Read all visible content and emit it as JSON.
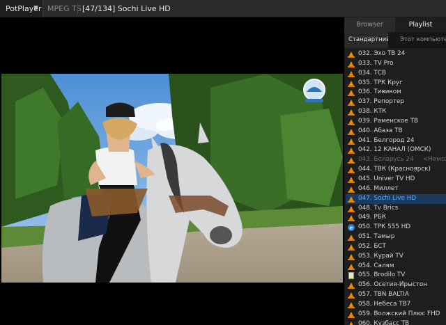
{
  "titlebar": {
    "app_menu": "PotPlayer",
    "format": "MPEG TS",
    "title": "[47/134] Sochi Live HD"
  },
  "panel": {
    "tabs": [
      {
        "label": "Browser",
        "active": false
      },
      {
        "label": "Playlist",
        "active": true
      }
    ],
    "subtabs": [
      {
        "label": "Стандартний",
        "active": true
      },
      {
        "label": "Этот компьютер",
        "active": false
      }
    ],
    "playlist": [
      {
        "label": "032. Эхо ТВ 24",
        "icon": "vlc-cone-icon"
      },
      {
        "label": "033. TV Pro",
        "icon": "vlc-cone-icon"
      },
      {
        "label": "034. ТСВ",
        "icon": "vlc-cone-icon"
      },
      {
        "label": "035. ТРК Круг",
        "icon": "vlc-cone-icon"
      },
      {
        "label": "036. Тивиком",
        "icon": "vlc-cone-icon"
      },
      {
        "label": "037. Репортер",
        "icon": "vlc-cone-icon"
      },
      {
        "label": "038. КТК",
        "icon": "vlc-cone-icon"
      },
      {
        "label": "039. Раменское ТВ",
        "icon": "vlc-cone-icon"
      },
      {
        "label": "040. Абаза ТВ",
        "icon": "vlc-cone-icon"
      },
      {
        "label": "041. Белгород 24",
        "icon": "vlc-cone-icon"
      },
      {
        "label": "042. 12 КАНАЛ (ОМСК)",
        "icon": "vlc-cone-icon"
      },
      {
        "label": "043. Беларусь 24",
        "suffix": "<Неможл",
        "icon": "vlc-cone-icon",
        "state": "dim"
      },
      {
        "label": "044. ТВК (Красноярск)",
        "icon": "vlc-cone-icon"
      },
      {
        "label": "045. Univer TV HD",
        "icon": "vlc-cone-icon"
      },
      {
        "label": "046. Миллет",
        "icon": "vlc-cone-icon"
      },
      {
        "label": "047. Sochi Live HD",
        "icon": "vlc-cone-icon",
        "state": "active"
      },
      {
        "label": "048. Tv Brics",
        "icon": "vlc-cone-icon"
      },
      {
        "label": "049. РБК",
        "icon": "vlc-cone-icon"
      },
      {
        "label": "050. ТРК 555 HD",
        "icon": "ie-icon"
      },
      {
        "label": "051. Тамыр",
        "icon": "vlc-cone-icon"
      },
      {
        "label": "052. БСТ",
        "icon": "vlc-cone-icon"
      },
      {
        "label": "053. Курай TV",
        "icon": "vlc-cone-icon"
      },
      {
        "label": "054. Салям",
        "icon": "vlc-cone-icon"
      },
      {
        "label": "055. Brodilo TV",
        "icon": "document-icon"
      },
      {
        "label": "056. Осетия-Ирыстон",
        "icon": "vlc-cone-icon"
      },
      {
        "label": "057. TBN BALTIA",
        "icon": "vlc-cone-icon"
      },
      {
        "label": "058. Небеса ТВ7",
        "icon": "vlc-cone-icon"
      },
      {
        "label": "059. Волжский Плюс FHD",
        "icon": "vlc-cone-icon"
      },
      {
        "label": "060. Кузбасс ТВ",
        "icon": "vlc-cone-icon"
      }
    ]
  },
  "colors": {
    "accent": "#56b4ff",
    "active_row": "#1c3a5e",
    "vlc_orange": "#f08a00"
  }
}
